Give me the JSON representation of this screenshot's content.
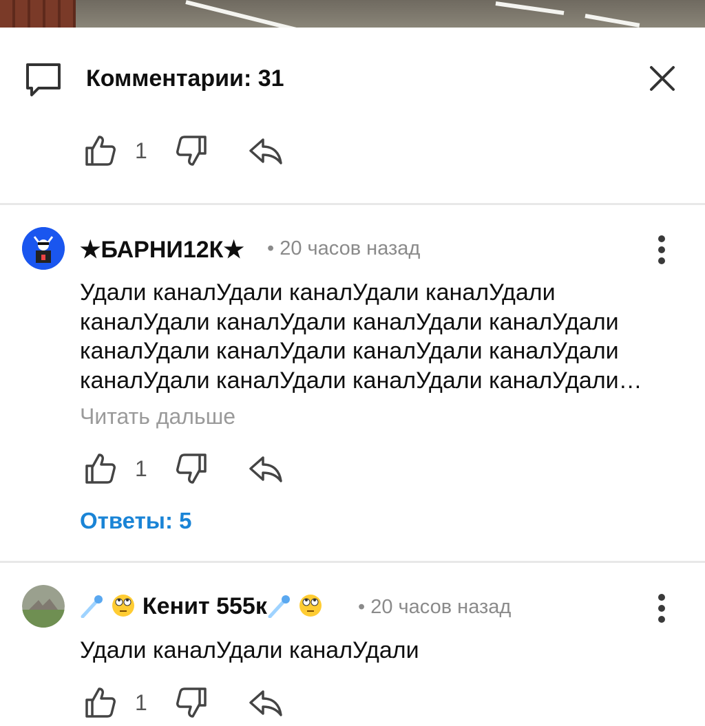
{
  "header": {
    "title": "Комментарии: 31",
    "icon": "comment-bubble-icon",
    "close_icon": "close-icon"
  },
  "top_actions": {
    "likes": "1"
  },
  "comments": [
    {
      "author": "★БАРНИ12К★",
      "time": "• 20 часов назад",
      "text_lines": [
        "Удали каналУдали каналУдали каналУдали",
        "каналУдали каналУдали каналУдали каналУдали",
        "каналУдали каналУдали каналУдали каналУдали",
        "каналУдали каналУдали каналУдали каналУдали…"
      ],
      "read_more": "Читать дальше",
      "likes": "1",
      "replies": "Ответы: 5"
    },
    {
      "author_prefix": "☄",
      "author_name": "Кенит 555к",
      "time": "• 20 часов назад",
      "text_lines": [
        "Удали каналУдали каналУдали"
      ],
      "likes": "1"
    }
  ],
  "colors": {
    "link": "#1a84d6",
    "muted": "#8a8a8a",
    "divider": "#e8e8e8"
  }
}
